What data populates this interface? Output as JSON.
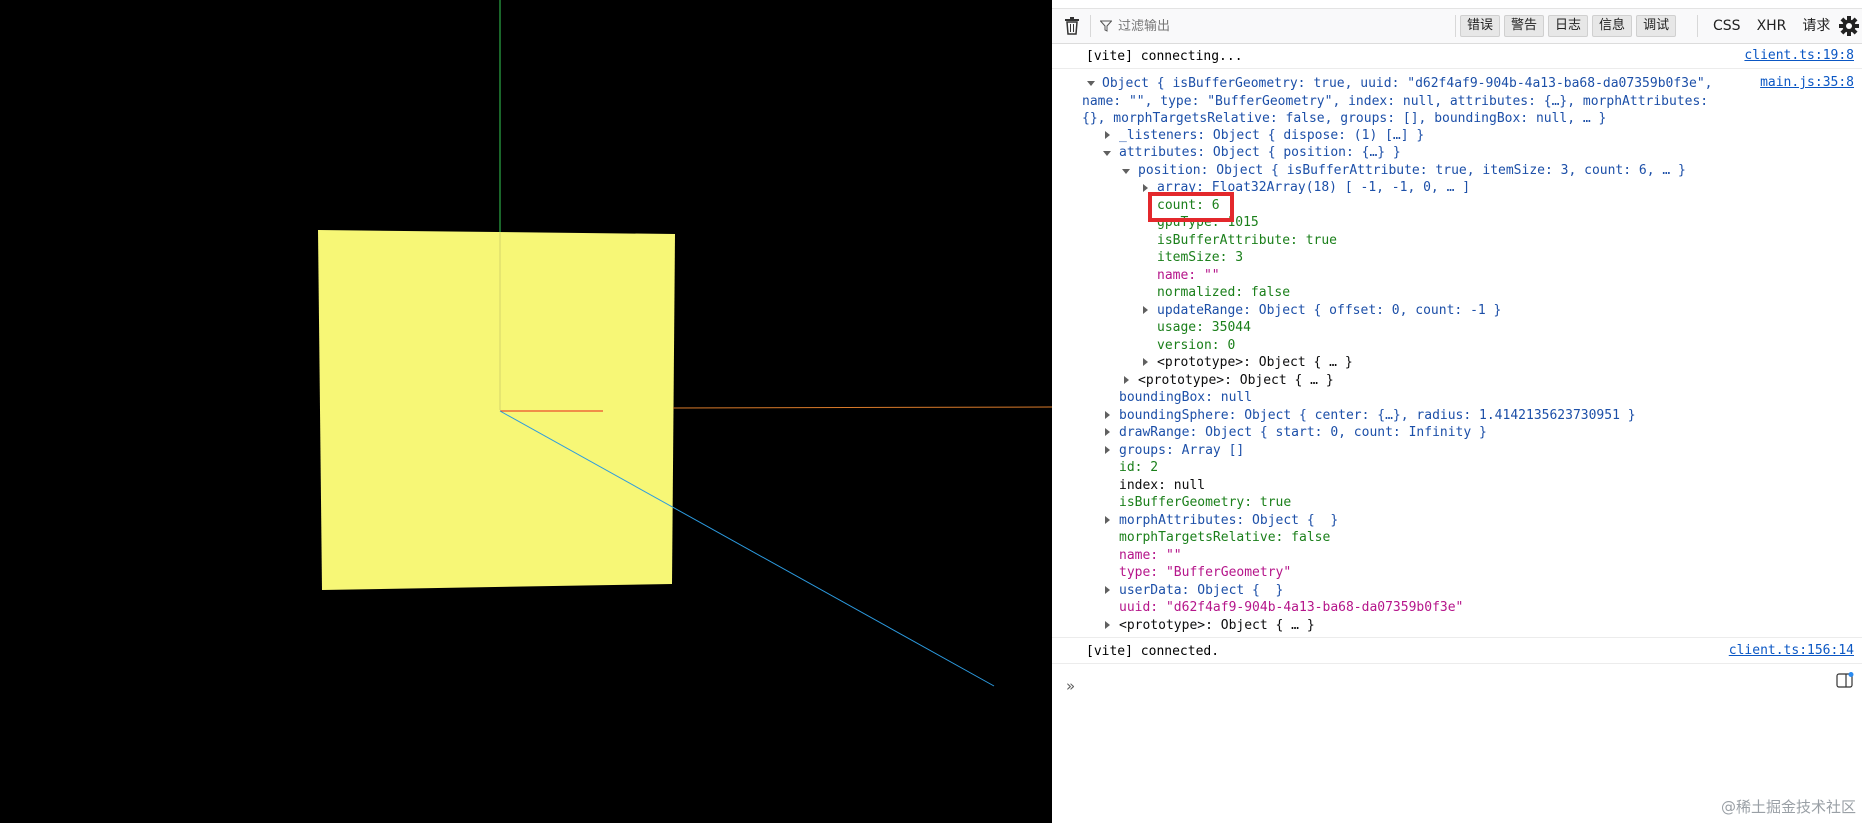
{
  "toolbar": {
    "filter_placeholder": "过滤输出",
    "levels": [
      "错误",
      "警告",
      "日志",
      "信息",
      "调试"
    ],
    "requests": [
      "CSS",
      "XHR",
      "请求"
    ]
  },
  "messages": {
    "vite_connecting": {
      "text": "[vite] connecting...",
      "source": "client.ts:19:8"
    },
    "object_source": "main.js:35:8",
    "vite_connected": {
      "text": "[vite] connected.",
      "source": "client.ts:156:14"
    }
  },
  "object": {
    "summary_l1": "Object { isBufferGeometry: true, uuid: \"d62f4af9-904b-4a13-ba68-da07359b0f3e\",",
    "summary_l2": "name: \"\", type: \"BufferGeometry\", index: null, attributes: {…}, morphAttributes:",
    "summary_l3": "{}, morphTargetsRelative: false, groups: [], boundingBox: null, … }",
    "listeners": "_listeners: Object { dispose: (1) […] }",
    "attributes": "attributes: Object { position: {…} }",
    "position": "position: Object { isBufferAttribute: true, itemSize: 3, count: 6, … }",
    "array": "array: Float32Array(18) [ -1, -1, 0, … ]",
    "count": "count: 6",
    "gpuType": "gpuType: 1015",
    "isBufferAttribute": "isBufferAttribute: true",
    "itemSize": "itemSize: 3",
    "name_attr": "name: \"\"",
    "normalized": "normalized: false",
    "updateRange": "updateRange: Object { offset: 0, count: -1 }",
    "usage": "usage: 35044",
    "version": "version: 0",
    "proto_inner": "<prototype>: Object { … }",
    "proto_attrs": "<prototype>: Object { … }",
    "boundingBox": "boundingBox: null",
    "boundingSphere": "boundingSphere: Object { center: {…}, radius: 1.4142135623730951 }",
    "drawRange": "drawRange: Object { start: 0, count: Infinity }",
    "groups": "groups: Array []",
    "id": "id: 2",
    "index": "index: null",
    "isBufferGeometry": "isBufferGeometry: true",
    "morphAttributes": "morphAttributes: Object {  }",
    "morphTargetsRelative": "morphTargetsRelative: false",
    "name": "name: \"\"",
    "type": "type: \"BufferGeometry\"",
    "userData": "userData: Object {  }",
    "uuid": "uuid: \"d62f4af9-904b-4a13-ba68-da07359b0f3e\"",
    "proto_outer": "<prototype>: Object { … }"
  },
  "watermark": "@稀土掘金技术社区",
  "colors": {
    "plane": "#f7f776",
    "axis_x": "#e8261a",
    "axis_y": "#33cc55",
    "axis_z": "#2c9be0",
    "highlight": "#e3282c"
  }
}
